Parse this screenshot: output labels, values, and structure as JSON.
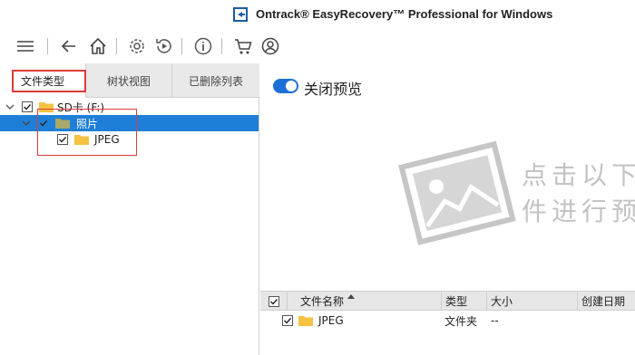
{
  "window": {
    "title": "Ontrack® EasyRecovery™ Professional for Windows",
    "icon": "app-logo-icon"
  },
  "toolbar": {
    "icons": [
      "menu-icon",
      "back-icon",
      "home-icon",
      "settings-icon",
      "recover-icon",
      "info-icon",
      "cart-icon",
      "account-icon"
    ]
  },
  "left_panel": {
    "tabs": [
      {
        "label": "文件类型",
        "active": true
      },
      {
        "label": "树状视图",
        "active": false
      },
      {
        "label": "已删除列表",
        "active": false
      }
    ],
    "tree": [
      {
        "label": "SD卡 (F:)",
        "checked": true,
        "expanded": true,
        "selected": false
      },
      {
        "label": "照片",
        "checked": true,
        "expanded": true,
        "selected": true
      },
      {
        "label": "JPEG",
        "checked": true,
        "expanded": false,
        "selected": false
      }
    ]
  },
  "right_panel": {
    "preview_toggle": {
      "label": "关闭预览",
      "on": true
    },
    "hint_lines": [
      "点击以下",
      "件进行预"
    ],
    "columns": [
      "文件名称",
      "类型",
      "大小",
      "创建日期"
    ],
    "rows": [
      {
        "name": "JPEG",
        "type": "文件夹",
        "size": "--",
        "date": "",
        "checked": true
      }
    ]
  },
  "colors": {
    "accent": "#1e7fd8",
    "highlight": "#e03a3a",
    "folder": "#f5c242"
  }
}
